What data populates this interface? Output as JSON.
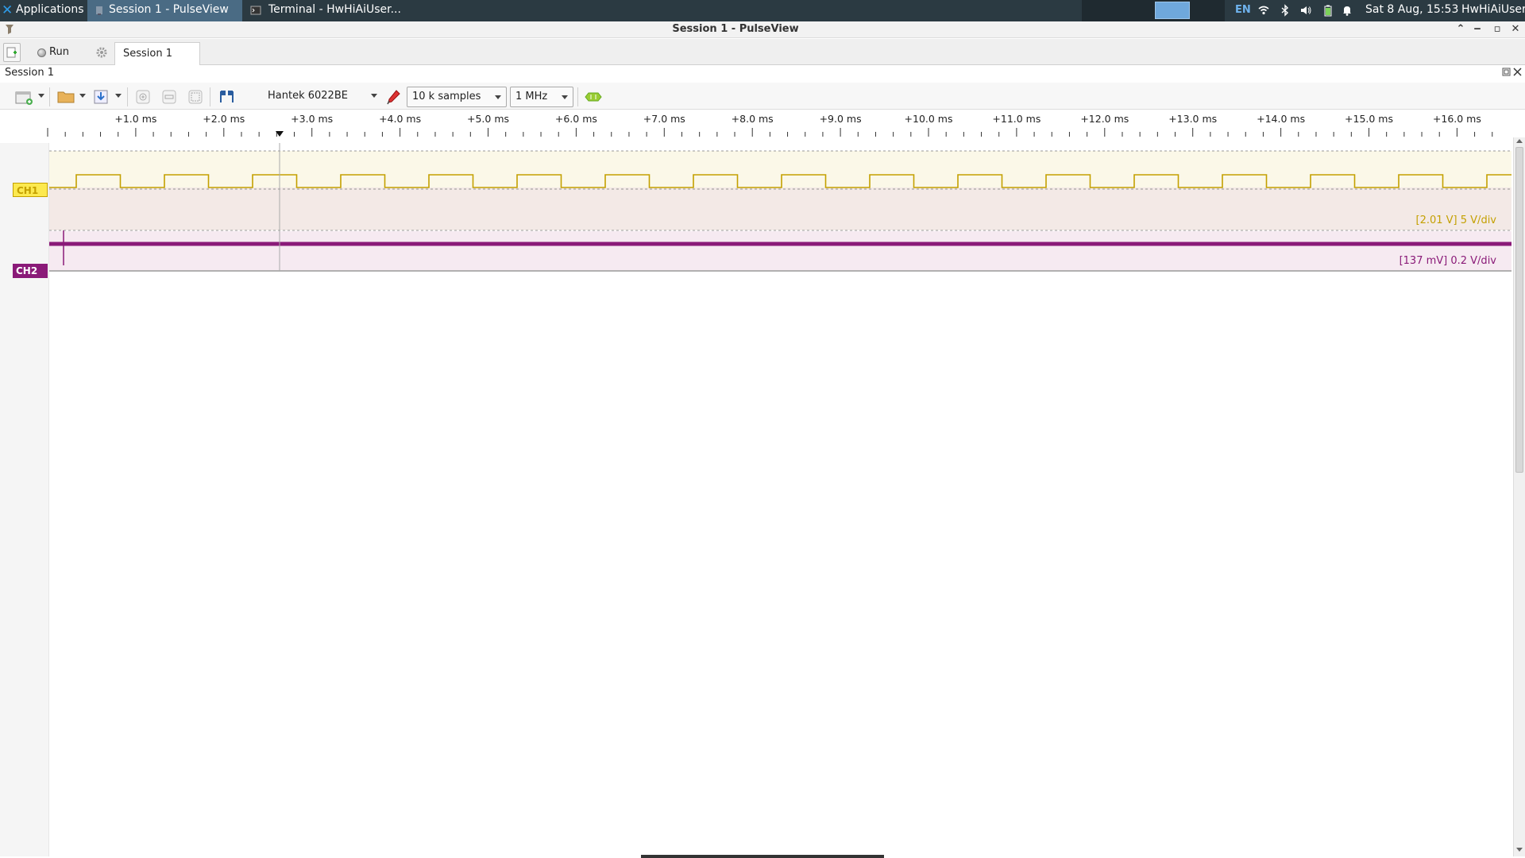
{
  "panel": {
    "apps_label": "Applications",
    "task_pulseview": "Session 1 - PulseView",
    "task_terminal": "Terminal - HwHiAiUser...",
    "lang": "EN",
    "clock": "Sat  8 Aug, 15:53",
    "user": "HwHiAiUser"
  },
  "window": {
    "title": "Session 1 - PulseView"
  },
  "tabbar": {
    "run_label": "Run",
    "session_tab": "Session 1"
  },
  "session": {
    "label": "Session 1"
  },
  "toolbar": {
    "device": "Hantek 6022BE",
    "samples": "10 k samples",
    "rate": "1 MHz"
  },
  "ruler": {
    "labels": [
      "+1.0 ms",
      "+2.0 ms",
      "+3.0 ms",
      "+4.0 ms",
      "+5.0 ms",
      "+6.0 ms",
      "+7.0 ms",
      "+8.0 ms",
      "+9.0 ms",
      "+10.0 ms",
      "+11.0 ms",
      "+12.0 ms",
      "+13.0 ms",
      "+14.0 ms",
      "+15.0 ms",
      "+16.0 ms"
    ]
  },
  "channels": {
    "ch1": {
      "name": "CH1",
      "scale": "[2.01 V] 5 V/div",
      "color": "#c4a000"
    },
    "ch2": {
      "name": "CH2",
      "scale": "[137 mV] 0.2 V/div",
      "color": "#8a1a78"
    }
  }
}
